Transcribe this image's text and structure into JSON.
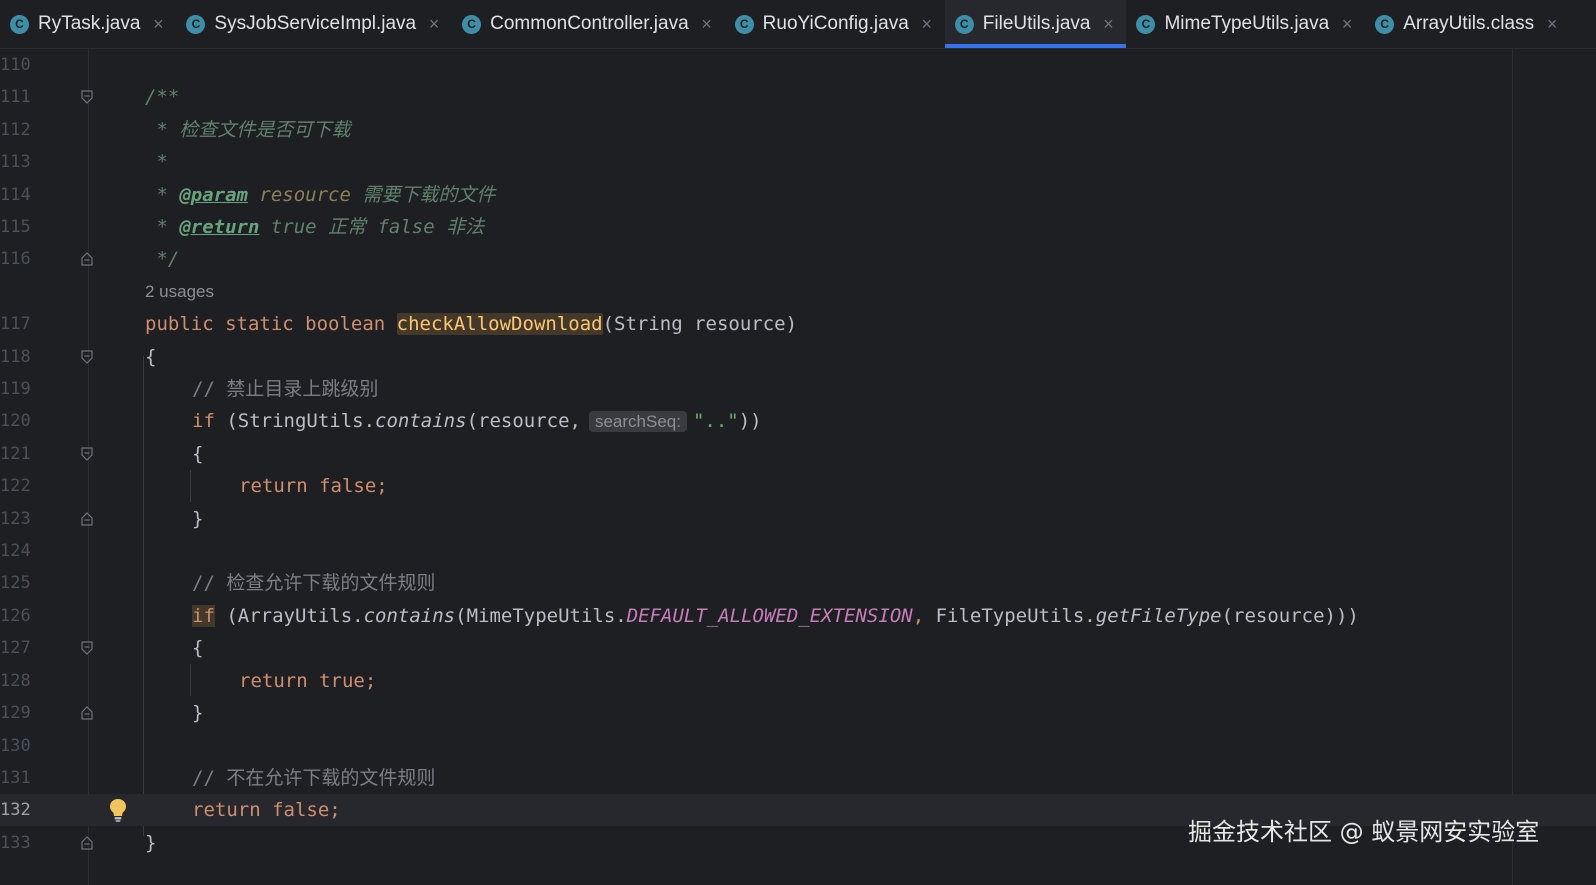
{
  "tabs": [
    {
      "name": "RyTask.java",
      "icon": "class-icon",
      "active": false
    },
    {
      "name": "SysJobServiceImpl.java",
      "icon": "class-icon",
      "active": false
    },
    {
      "name": "CommonController.java",
      "icon": "class-icon",
      "active": false
    },
    {
      "name": "RuoYiConfig.java",
      "icon": "class-icon",
      "active": false
    },
    {
      "name": "FileUtils.java",
      "icon": "class-icon",
      "active": true
    },
    {
      "name": "MimeTypeUtils.java",
      "icon": "class-icon",
      "active": false
    },
    {
      "name": "ArrayUtils.class",
      "icon": "class-icon",
      "active": false
    }
  ],
  "tab_icon_letter": "C",
  "close_glyph": "×",
  "editor": {
    "line_numbers": [
      "110",
      "111",
      "112",
      "113",
      "114",
      "115",
      "116",
      "117",
      "118",
      "119",
      "120",
      "121",
      "122",
      "123",
      "124",
      "125",
      "126",
      "127",
      "128",
      "129",
      "130",
      "131",
      "132",
      "133"
    ],
    "current_line": "132",
    "usages_hint": "2 usages",
    "param_hint": "searchSeq:",
    "code": {
      "l111": "/**",
      "l112_star": " * ",
      "l112_text": "检查文件是否可下载",
      "l113": " *",
      "l114_star": " * ",
      "l114_tag": "@param",
      "l114_ref": " resource",
      "l114_text": " 需要下载的文件",
      "l115_star": " * ",
      "l115_tag": "@return",
      "l115_text": " true 正常 false 非法",
      "l116": " */",
      "l117_kw": "public static boolean ",
      "l117_fn": "checkAllowDownload",
      "l117_rest": "(String resource)",
      "l118": "{",
      "l119": "// 禁止目录上跳级别",
      "l120_kw": "if",
      "l120_a": " (StringUtils.",
      "l120_fn": "contains",
      "l120_b": "(resource,",
      "l120_str": "\"..\"",
      "l120_c": "))",
      "l121": "{",
      "l122": "return false;",
      "l123": "}",
      "l125": "// 检查允许下载的文件规则",
      "l126_kw": "if",
      "l126_a": " (ArrayUtils.",
      "l126_fn": "contains",
      "l126_b": "(MimeTypeUtils.",
      "l126_const": "DEFAULT_ALLOWED_EXTENSION",
      "l126_comma": ", ",
      "l126_c": "FileTypeUtils.",
      "l126_fn2": "getFileType",
      "l126_d": "(resource)))",
      "l127": "{",
      "l128": "return true;",
      "l129": "}",
      "l131": "// 不在允许下载的文件规则",
      "l132": "return false;",
      "l133": "}"
    }
  },
  "watermark": "掘金技术社区 @ 蚁景网安实验室",
  "colors": {
    "background": "#1e1f22",
    "keyword": "#cf8e6d",
    "doc_comment": "#5f826b",
    "comment": "#7a7e85",
    "string": "#6aab73",
    "constant": "#c77dbb",
    "active_tab_underline": "#3574f0"
  }
}
